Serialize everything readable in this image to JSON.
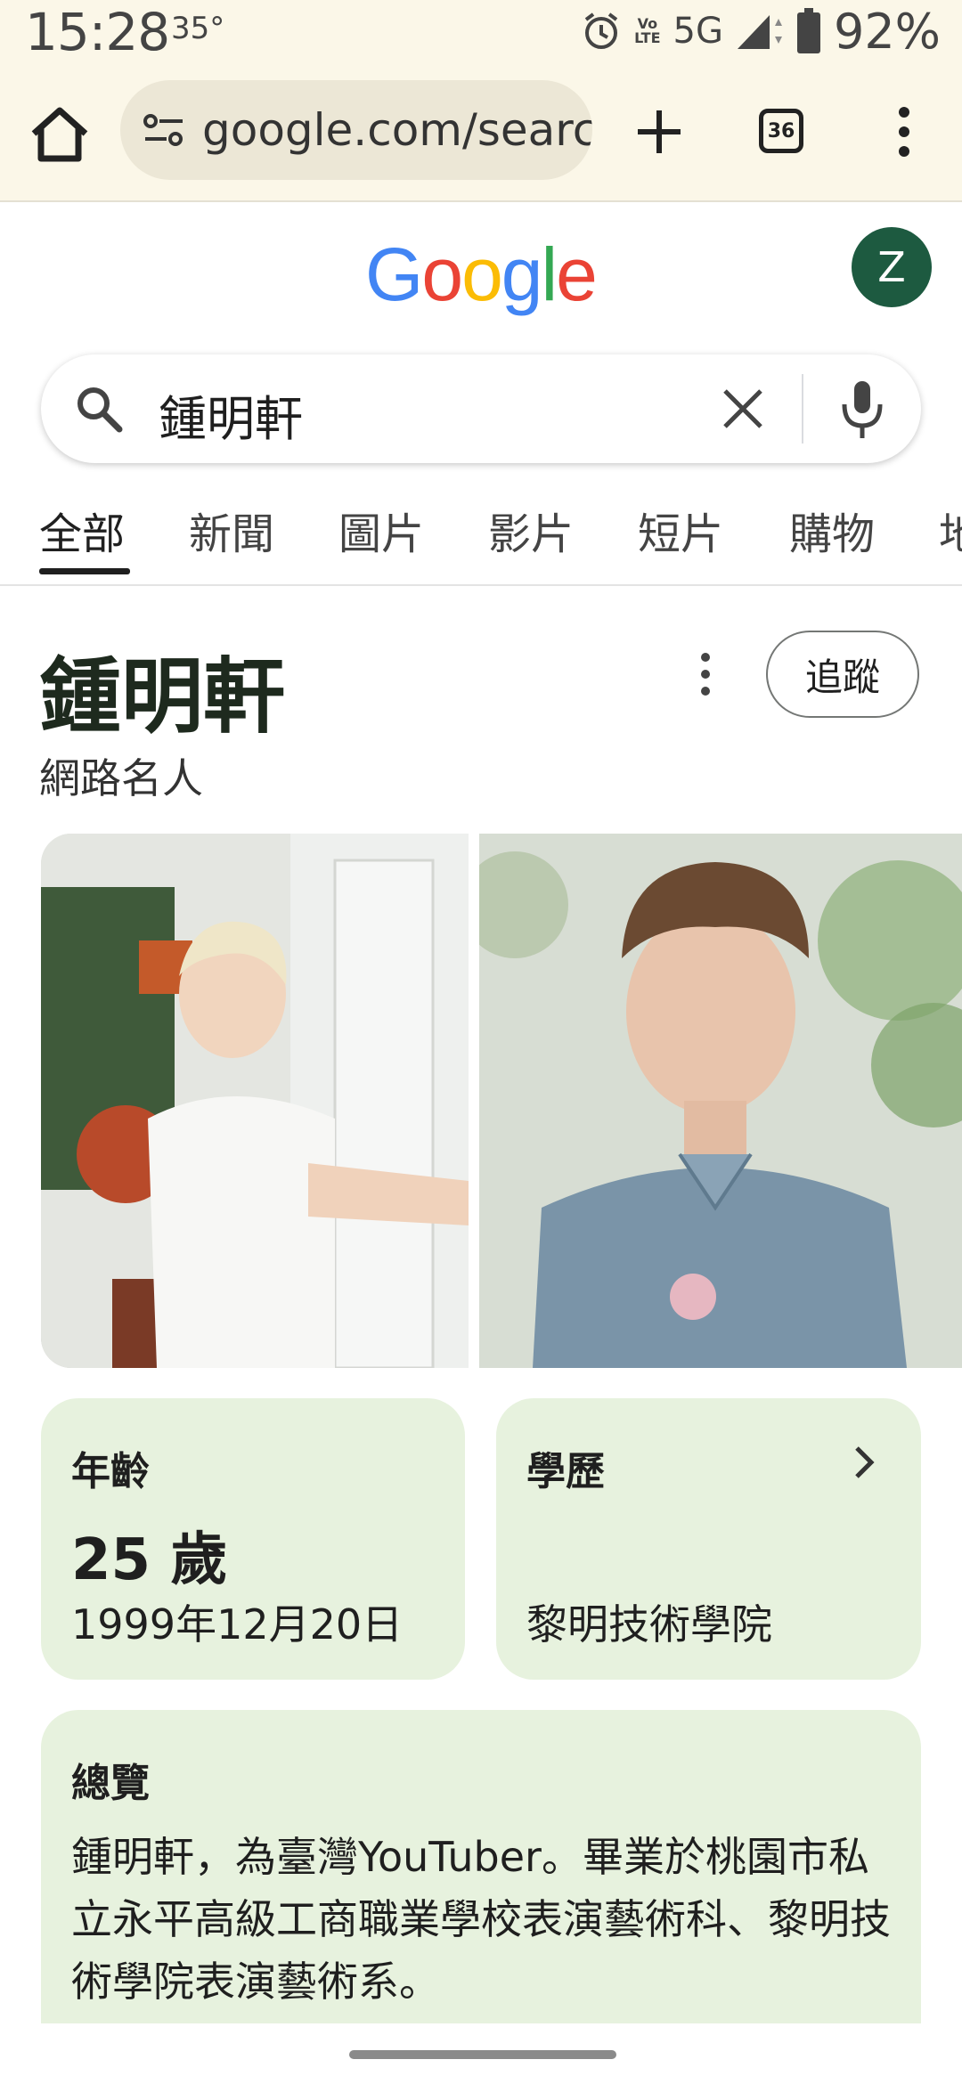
{
  "status_bar": {
    "time": "15:28",
    "temperature": "35°",
    "network": "5G",
    "lte_label": "LTE",
    "volte_label": "Vo",
    "battery": "92%"
  },
  "browser": {
    "url": "google.com/search",
    "tab_count": "36"
  },
  "google": {
    "logo_text": "Google",
    "avatar_letter": "Z"
  },
  "search": {
    "query": "鍾明軒"
  },
  "tabs": [
    {
      "label": "全部"
    },
    {
      "label": "新聞"
    },
    {
      "label": "圖片"
    },
    {
      "label": "影片"
    },
    {
      "label": "短片"
    },
    {
      "label": "購物"
    },
    {
      "label": "地"
    }
  ],
  "knowledge_panel": {
    "title": "鍾明軒",
    "subtitle": "網路名人",
    "follow_label": "追蹤",
    "age_card": {
      "label": "年齡",
      "value": "25 歲",
      "birthdate": "1999年12月20日"
    },
    "education_card": {
      "label": "學歷",
      "value": "黎明技術學院"
    },
    "overview": {
      "title": "總覽",
      "text": "鍾明軒，為臺灣YouTuber。畢業於桃園市私立永平高級工商職業學校表演藝術科、黎明技術學院表演藝術系。"
    }
  },
  "colors": {
    "toolbar_bg": "#fbf7e8",
    "card_bg": "#e7f2de",
    "avatar_bg": "#1d5a40"
  }
}
